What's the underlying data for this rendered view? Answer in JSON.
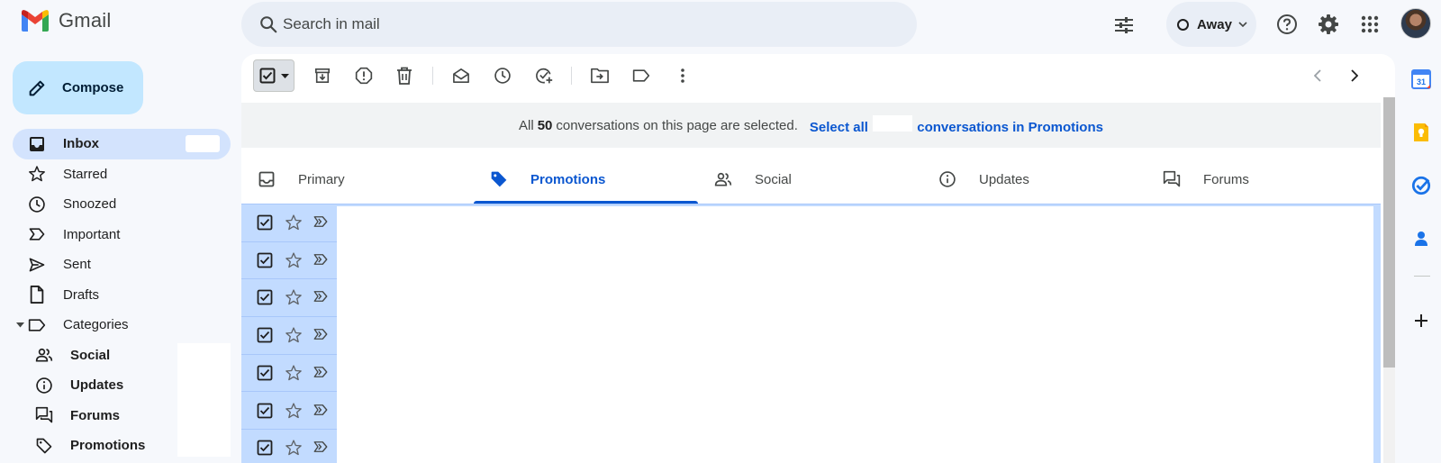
{
  "app": {
    "name": "Gmail"
  },
  "search": {
    "placeholder": "Search in mail"
  },
  "status": {
    "label": "Away"
  },
  "compose": {
    "label": "Compose"
  },
  "nav": {
    "inbox": "Inbox",
    "starred": "Starred",
    "snoozed": "Snoozed",
    "important": "Important",
    "sent": "Sent",
    "drafts": "Drafts",
    "categories": "Categories",
    "social": "Social",
    "updates": "Updates",
    "forums": "Forums",
    "promotions": "Promotions"
  },
  "banner": {
    "prefix": "All",
    "count": "50",
    "middle": "conversations on this page are selected.",
    "select_all": "Select all",
    "suffix": "conversations in Promotions"
  },
  "tabs": [
    {
      "label": "Primary",
      "icon": "inbox-icon"
    },
    {
      "label": "Promotions",
      "icon": "tag-icon",
      "active": true
    },
    {
      "label": "Social",
      "icon": "people-icon"
    },
    {
      "label": "Updates",
      "icon": "info-icon"
    },
    {
      "label": "Forums",
      "icon": "forum-icon"
    }
  ],
  "calendar": {
    "day": "31"
  },
  "colors": {
    "accent": "#0b57d0",
    "selected_row": "#c2dbff",
    "compose": "#c2e7ff"
  }
}
